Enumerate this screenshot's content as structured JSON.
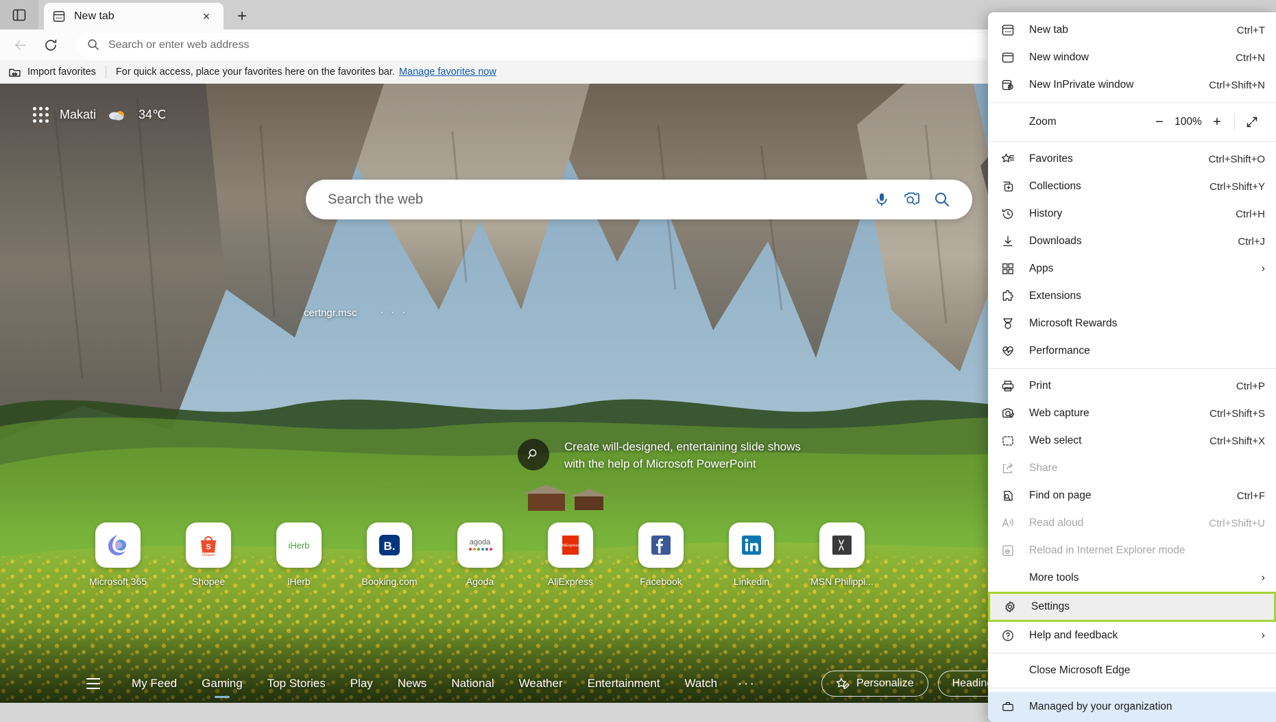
{
  "window": {
    "tab_search_icon": "tab-search-icon"
  },
  "tabstrip": {
    "tabs": [
      {
        "title": "New tab",
        "favicon": "newtab-icon",
        "close_label": "×"
      }
    ],
    "new_tab_label": "+"
  },
  "toolbar": {
    "back_icon": "back-arrow-icon",
    "refresh_icon": "refresh-icon",
    "omnibox": {
      "icon": "search-icon",
      "placeholder": "Search or enter web address",
      "value": ""
    }
  },
  "favorites_bar": {
    "import_label": "Import favorites",
    "import_icon": "import-favorites-icon",
    "message": "For quick access, place your favorites here on the favorites bar.",
    "manage_link": "Manage favorites now"
  },
  "new_tab_page": {
    "apps_grid_icon": "app-grid-icon",
    "weather": {
      "city": "Makati",
      "icon": "partly-cloudy-icon",
      "temperature": "34℃"
    },
    "search": {
      "placeholder": "Search the web",
      "mic_icon": "microphone-icon",
      "lens_icon": "visual-search-icon",
      "search_icon": "search-icon"
    },
    "suggestion": {
      "text": "certngr.msc",
      "more": "· · ·"
    },
    "promo": {
      "badge_icon": "magnifier-icon",
      "text": "Create will-designed, entertaining slide shows with the help of Microsoft PowerPoint"
    },
    "shortcuts": [
      {
        "label": "Microsoft 365",
        "icon": "microsoft365-icon"
      },
      {
        "label": "Shopee",
        "icon": "shopee-icon"
      },
      {
        "label": "iHerb",
        "icon": "iherb-icon"
      },
      {
        "label": "Booking.com",
        "icon": "booking-icon"
      },
      {
        "label": "Agoda",
        "icon": "agoda-icon"
      },
      {
        "label": "AliExpress",
        "icon": "aliexpress-icon"
      },
      {
        "label": "Facebook",
        "icon": "facebook-icon"
      },
      {
        "label": "Linkedin",
        "icon": "linkedin-icon"
      },
      {
        "label": "MSN Philippi...",
        "icon": "msn-icon"
      }
    ],
    "feed_nav": {
      "menu_icon": "hamburger-icon",
      "items": [
        {
          "label": "My Feed",
          "active": false
        },
        {
          "label": "Gaming",
          "active": true
        },
        {
          "label": "Top Stories",
          "active": false
        },
        {
          "label": "Play",
          "active": false
        },
        {
          "label": "News",
          "active": false
        },
        {
          "label": "National",
          "active": false
        },
        {
          "label": "Weather",
          "active": false
        },
        {
          "label": "Entertainment",
          "active": false
        },
        {
          "label": "Watch",
          "active": false
        }
      ],
      "more": "···",
      "personalize_label": "Personalize",
      "personalize_icon": "star-pencil-icon",
      "headings_label": "Headings only"
    }
  },
  "edge_menu": {
    "groups": [
      {
        "items": [
          {
            "label": "New tab",
            "shortcut": "Ctrl+T",
            "icon": "newtab-icon",
            "state": "normal"
          },
          {
            "label": "New window",
            "shortcut": "Ctrl+N",
            "icon": "newwindow-icon",
            "state": "normal"
          },
          {
            "label": "New InPrivate window",
            "shortcut": "Ctrl+Shift+N",
            "icon": "inprivate-icon",
            "state": "normal"
          }
        ]
      },
      {
        "zoom_row": {
          "label": "Zoom",
          "minus_label": "−",
          "value": "100%",
          "plus_label": "+",
          "fullscreen_icon": "fullscreen-icon"
        }
      },
      {
        "items": [
          {
            "label": "Favorites",
            "shortcut": "Ctrl+Shift+O",
            "icon": "favorites-star-icon",
            "state": "normal"
          },
          {
            "label": "Collections",
            "shortcut": "Ctrl+Shift+Y",
            "icon": "collections-icon",
            "state": "normal"
          },
          {
            "label": "History",
            "shortcut": "Ctrl+H",
            "icon": "history-icon",
            "state": "normal"
          },
          {
            "label": "Downloads",
            "shortcut": "Ctrl+J",
            "icon": "downloads-icon",
            "state": "normal"
          },
          {
            "label": "Apps",
            "shortcut": "",
            "icon": "apps-icon",
            "state": "submenu"
          },
          {
            "label": "Extensions",
            "shortcut": "",
            "icon": "extensions-icon",
            "state": "normal"
          },
          {
            "label": "Microsoft Rewards",
            "shortcut": "",
            "icon": "rewards-icon",
            "state": "normal"
          },
          {
            "label": "Performance",
            "shortcut": "",
            "icon": "performance-icon",
            "state": "normal"
          }
        ]
      },
      {
        "items": [
          {
            "label": "Print",
            "shortcut": "Ctrl+P",
            "icon": "print-icon",
            "state": "normal"
          },
          {
            "label": "Web capture",
            "shortcut": "Ctrl+Shift+S",
            "icon": "webcapture-icon",
            "state": "normal"
          },
          {
            "label": "Web select",
            "shortcut": "Ctrl+Shift+X",
            "icon": "webselect-icon",
            "state": "normal"
          },
          {
            "label": "Share",
            "shortcut": "",
            "icon": "share-icon",
            "state": "disabled"
          },
          {
            "label": "Find on page",
            "shortcut": "Ctrl+F",
            "icon": "find-icon",
            "state": "normal"
          },
          {
            "label": "Read aloud",
            "shortcut": "Ctrl+Shift+U",
            "icon": "readaloud-icon",
            "state": "disabled"
          },
          {
            "label": "Reload in Internet Explorer mode",
            "shortcut": "",
            "icon": "ie-mode-icon",
            "state": "disabled"
          },
          {
            "label": "More tools",
            "shortcut": "",
            "icon": "",
            "state": "submenu"
          }
        ]
      },
      {
        "items": [
          {
            "label": "Settings",
            "shortcut": "",
            "icon": "gear-icon",
            "state": "highlighted"
          },
          {
            "label": "Help and feedback",
            "shortcut": "",
            "icon": "help-icon",
            "state": "submenu"
          }
        ]
      },
      {
        "items": [
          {
            "label": "Close Microsoft Edge",
            "shortcut": "",
            "icon": "",
            "state": "normal"
          }
        ]
      },
      {
        "items": [
          {
            "label": "Managed by your organization",
            "shortcut": "",
            "icon": "briefcase-icon",
            "state": "managed"
          }
        ]
      }
    ]
  },
  "colors": {
    "highlight_border": "#a4d533",
    "managed_bg": "#deecf9",
    "link": "#0f5ab0",
    "tab_active_bg": "#fbfbfb"
  }
}
